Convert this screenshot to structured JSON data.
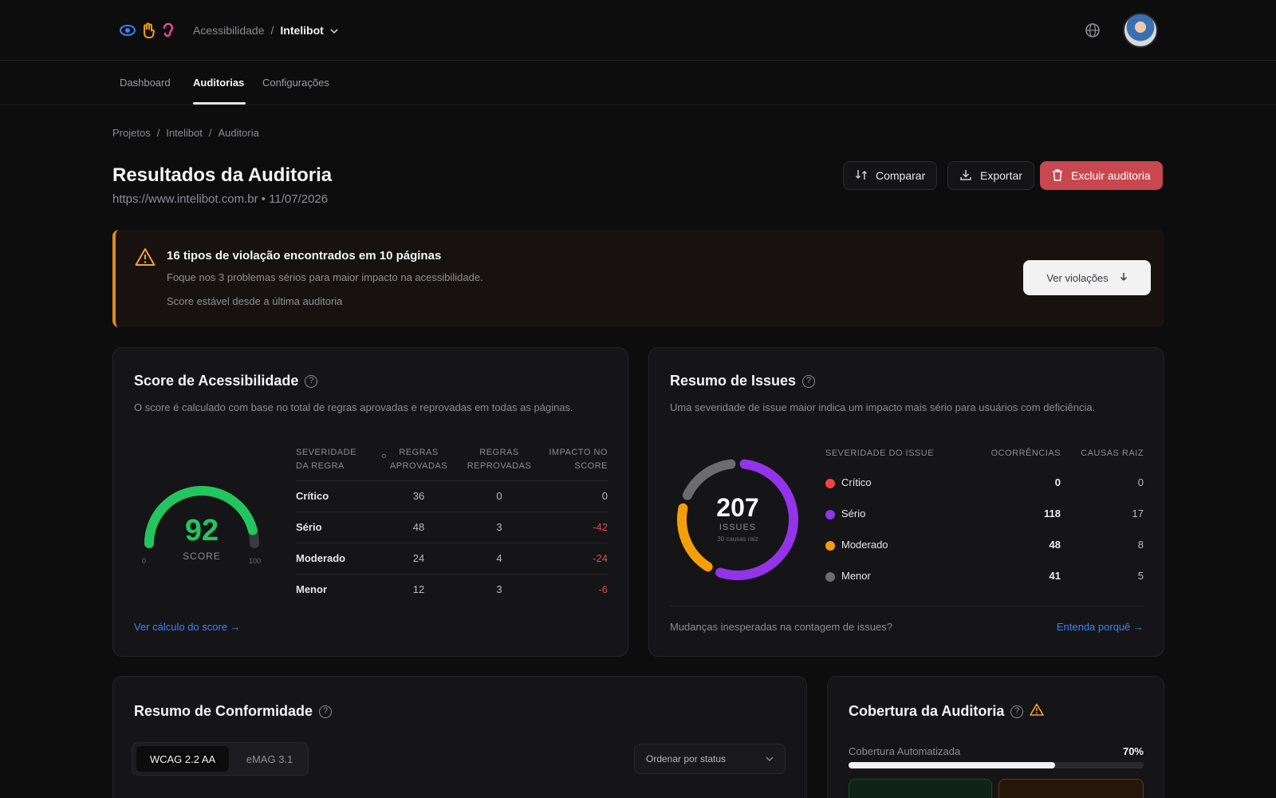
{
  "header": {
    "crumb_root": "Acessibilidade",
    "crumb_sep": "/",
    "project": "Intelibot"
  },
  "nav": {
    "tabs": [
      {
        "label": "Dashboard"
      },
      {
        "label": "Auditorias"
      },
      {
        "label": "Configurações"
      }
    ],
    "active": "Auditorias"
  },
  "breadcrumb": [
    "Projetos",
    "Intelibot",
    "Auditoria"
  ],
  "breadcrumb_sep": "/",
  "page": {
    "title": "Resultados da Auditoria",
    "subtitle": "https://www.intelibot.com.br • 11/07/2026"
  },
  "actions": {
    "compare": "Comparar",
    "export": "Exportar",
    "delete": "Excluir auditoria"
  },
  "alert": {
    "title": "16 tipos de violação encontrados em 10 páginas",
    "line1": "Foque nos 3 problemas sérios para maior impacto na acessibilidade.",
    "line2": "Score estável desde a última auditoria",
    "button": "Ver violações"
  },
  "score_card": {
    "title": "Score de Acessibilidade",
    "description": "O score é calculado com base no total de regras aprovadas e reprovadas em todas as páginas.",
    "gauge": {
      "value": 92,
      "label": "SCORE",
      "min": "0",
      "max": "100",
      "color": "#22c55e"
    },
    "columns": [
      "SEVERIDADE DA REGRA",
      "REGRAS APROVADAS",
      "REGRAS REPROVADAS",
      "IMPACTO NO SCORE"
    ],
    "rows": [
      {
        "severity": "Crítico",
        "approved": "36",
        "failed": "0",
        "impact": "0"
      },
      {
        "severity": "Sério",
        "approved": "48",
        "failed": "3",
        "impact": "-42"
      },
      {
        "severity": "Moderado",
        "approved": "24",
        "failed": "4",
        "impact": "-24"
      },
      {
        "severity": "Menor",
        "approved": "12",
        "failed": "3",
        "impact": "-6"
      }
    ],
    "link": "Ver cálculo do score →"
  },
  "issues_card": {
    "title": "Resumo de Issues",
    "description": "Uma severidade de issue maior indica um impacto mais sério para usuários com deficiência.",
    "donut": {
      "total": "207",
      "label": "ISSUES",
      "sublabel": "30 causas raiz"
    },
    "columns": [
      "SEVERIDADE DO ISSUE",
      "OCORRÊNCIAS",
      "CAUSAS RAIZ"
    ],
    "rows": [
      {
        "severity": "Crítico",
        "occurrences": 0,
        "root": "0",
        "color": "#ef4444"
      },
      {
        "severity": "Sério",
        "occurrences": 118,
        "root": "17",
        "color": "#9333ea"
      },
      {
        "severity": "Moderado",
        "occurrences": 48,
        "root": "8",
        "color": "#f59e0b"
      },
      {
        "severity": "Menor",
        "occurrences": 41,
        "root": "5",
        "color": "#6b6b70"
      }
    ],
    "footer_text": "Mudanças inesperadas na contagem de issues?",
    "footer_link": "Entenda porquê →"
  },
  "conformance_card": {
    "title": "Resumo de Conformidade",
    "tabs": [
      "WCAG 2.2 AA",
      "eMAG 3.1"
    ],
    "sort_label": "Ordenar por status"
  },
  "coverage_card": {
    "title": "Cobertura da Auditoria",
    "label": "Cobertura Automatizada",
    "percent_label": "70%",
    "percent": 0.7
  },
  "icons": {
    "logo": [
      "eye-icon",
      "hand-icon",
      "ear-icon"
    ],
    "globe": "globe-icon",
    "warning": "warning-icon",
    "help": "help-icon"
  }
}
